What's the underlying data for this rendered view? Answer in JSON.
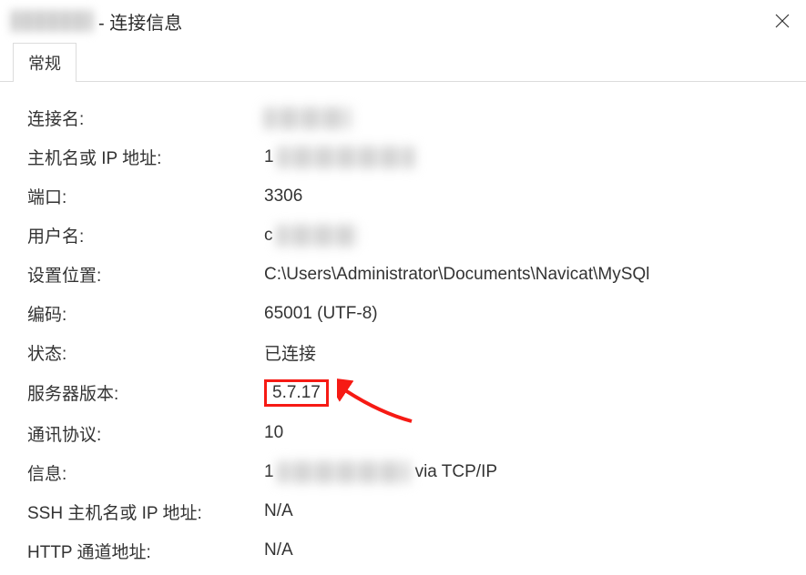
{
  "titlebar": {
    "suffix": "- 连接信息"
  },
  "tabs": {
    "general": "常规"
  },
  "fields": {
    "conn_name": {
      "label": "连接名:"
    },
    "host": {
      "label": "主机名或 IP 地址:",
      "prefix": "1"
    },
    "port": {
      "label": "端口:",
      "value": "3306"
    },
    "user": {
      "label": "用户名:",
      "prefix": "c"
    },
    "settings": {
      "label": "设置位置:",
      "value": "C:\\Users\\Administrator\\Documents\\Navicat\\MySQl"
    },
    "encoding": {
      "label": "编码:",
      "value": "65001 (UTF-8)"
    },
    "status": {
      "label": "状态:",
      "value": "已连接"
    },
    "server_ver": {
      "label": "服务器版本:",
      "value": "5.7.17"
    },
    "protocol": {
      "label": "通讯协议:",
      "value": "10"
    },
    "info": {
      "label": "信息:",
      "prefix": "1",
      "suffix": "via TCP/IP"
    },
    "ssh_host": {
      "label": "SSH 主机名或 IP 地址:",
      "value": "N/A"
    },
    "http_tun": {
      "label": "HTTP 通道地址:",
      "value": "N/A"
    }
  }
}
